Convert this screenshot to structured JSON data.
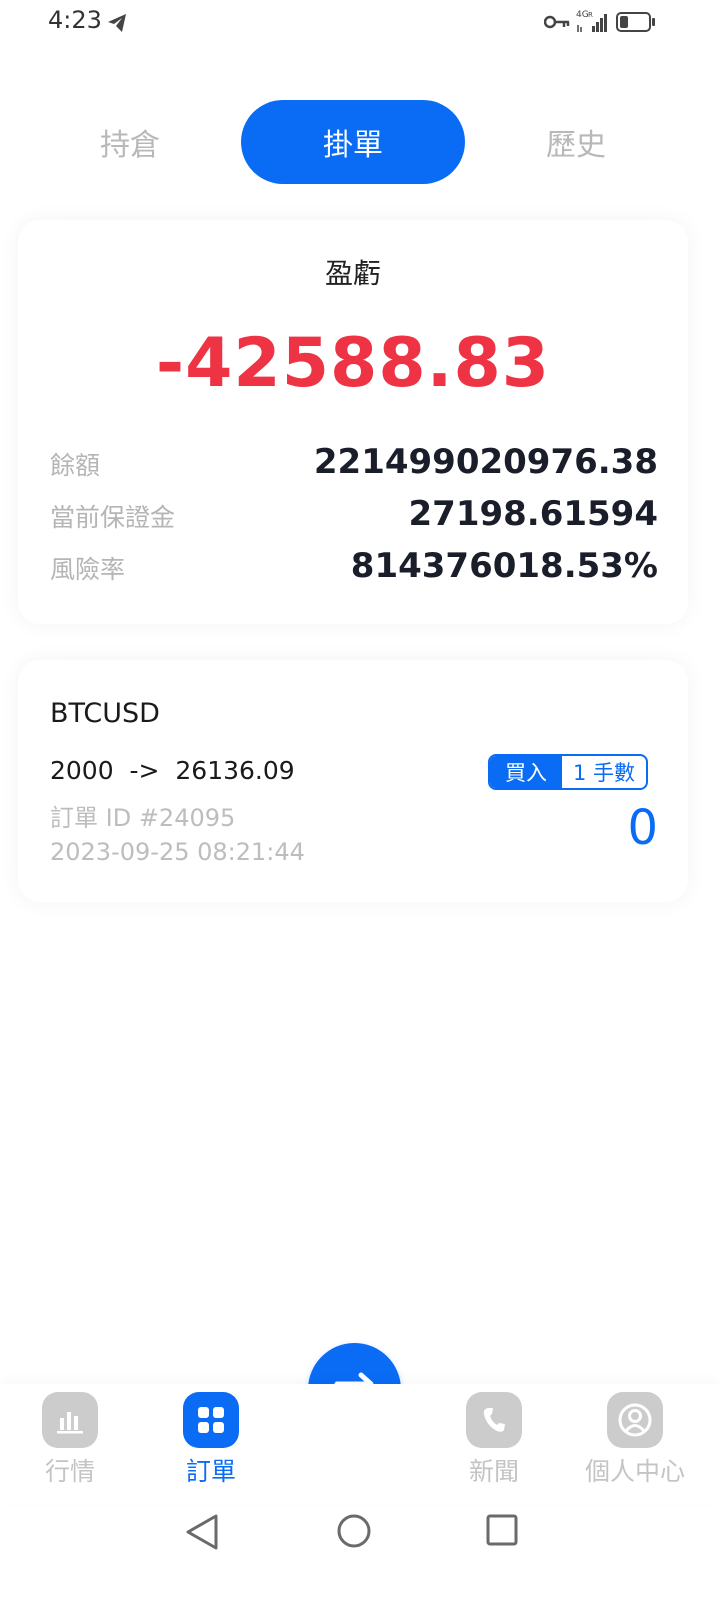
{
  "status_bar": {
    "time": "4:23",
    "icons": [
      "telegram-icon",
      "key-icon",
      "signal-4g-icon",
      "battery-icon"
    ]
  },
  "tabs": [
    {
      "label": "持倉",
      "active": false
    },
    {
      "label": "掛單",
      "active": true
    },
    {
      "label": "歷史",
      "active": false
    }
  ],
  "summary": {
    "pnl_label": "盈虧",
    "pnl_value": "-42588.83",
    "rows": [
      {
        "label": "餘額",
        "value": "221499020976.38"
      },
      {
        "label": "當前保證金",
        "value": "27198.61594"
      },
      {
        "label": "風險率",
        "value": "814376018.53%"
      }
    ]
  },
  "order": {
    "symbol": "BTCUSD",
    "prices": "2000  ->  26136.09",
    "id": "訂單 ID #24095",
    "time": "2023-09-25 08:21:44",
    "side": "買入",
    "lots": "1 手數",
    "pnl": "0"
  },
  "bottom_nav": [
    {
      "label": "行情",
      "icon": "bar-chart-icon",
      "active": false
    },
    {
      "label": "訂單",
      "icon": "grid-icon",
      "active": true
    },
    {
      "label": "新聞",
      "icon": "phone-icon",
      "active": false
    },
    {
      "label": "個人中心",
      "icon": "person-icon",
      "active": false
    }
  ],
  "fab": {
    "icon": "swap-arrows-icon"
  },
  "colors": {
    "accent": "#0a6cf5",
    "loss": "#ee3344",
    "muted": "#b5b5b5",
    "inactive_icon": "#cccccc"
  }
}
